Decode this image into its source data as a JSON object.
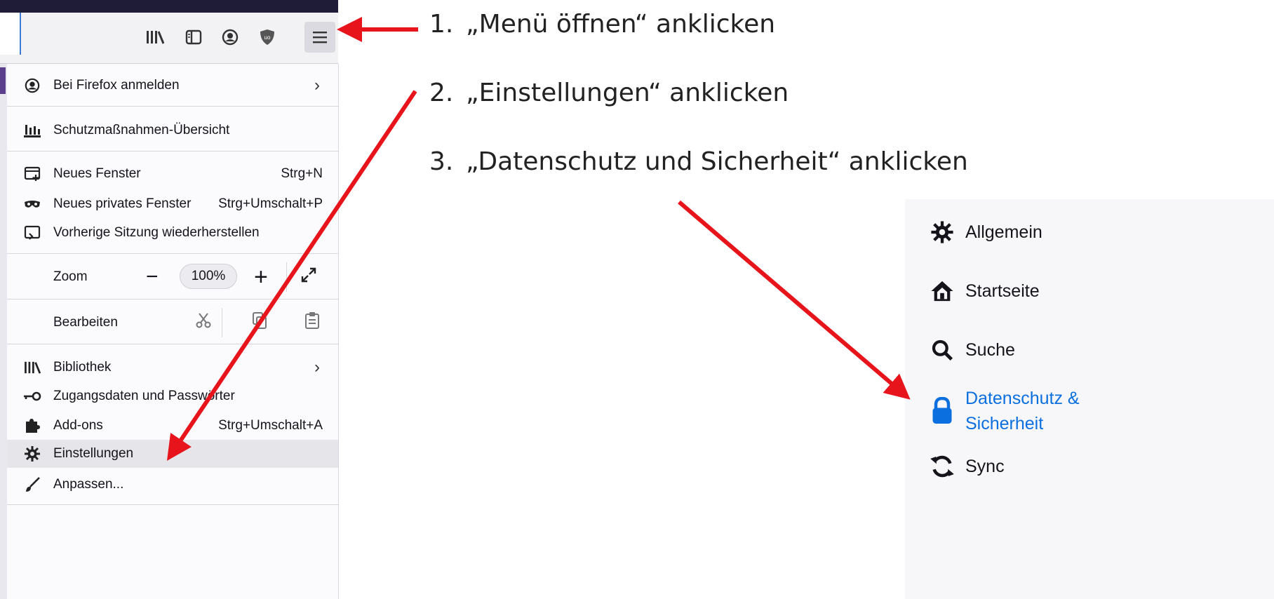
{
  "firefox": {
    "menu": {
      "sign_in": "Bei Firefox anmelden",
      "protections": "Schutzmaßnahmen-Übersicht",
      "new_window": {
        "label": "Neues Fenster",
        "shortcut": "Strg+N"
      },
      "private_window": {
        "label": "Neues privates Fenster",
        "shortcut": "Strg+Umschalt+P"
      },
      "restore_session": "Vorherige Sitzung wiederherstellen",
      "zoom": {
        "label": "Zoom",
        "minus": "−",
        "value": "100%",
        "plus": "+"
      },
      "edit": {
        "label": "Bearbeiten"
      },
      "library": "Bibliothek",
      "logins": "Zugangsdaten und Passwörter",
      "addons": {
        "label": "Add-ons",
        "shortcut": "Strg+Umschalt+A"
      },
      "settings": "Einstellungen",
      "customize": "Anpassen..."
    }
  },
  "steps": [
    {
      "num": "1.",
      "text": "„Menü öffnen“ anklicken"
    },
    {
      "num": "2.",
      "text": "„Einstellungen“ anklicken"
    },
    {
      "num": "3.",
      "text": "„Datenschutz und Sicherheit“ anklicken"
    }
  ],
  "preferences": {
    "items": [
      {
        "label": "Allgemein",
        "icon": "gear-icon"
      },
      {
        "label": "Startseite",
        "icon": "home-icon"
      },
      {
        "label": "Suche",
        "icon": "search-icon"
      },
      {
        "label": "Datenschutz &",
        "label2": "Sicherheit",
        "icon": "lock-icon",
        "active": true
      },
      {
        "label": "Sync",
        "icon": "sync-icon"
      }
    ]
  },
  "colors": {
    "arrow": "#e8141b",
    "active_pref": "#0b6fe0",
    "topbar": "#1e1c36"
  }
}
